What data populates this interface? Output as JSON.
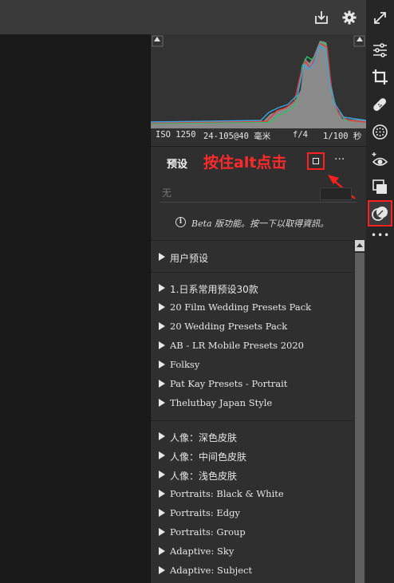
{
  "topbar": {
    "export_icon": "export-icon",
    "settings_icon": "gear-icon"
  },
  "exif": {
    "iso": "ISO 1250",
    "lens": "24-105@40 毫米",
    "aperture": "f/4",
    "shutter": "1/100 秒"
  },
  "presets": {
    "title": "预设",
    "annotation": "按住alt点击",
    "more_label": "···",
    "search_placeholder": "无",
    "beta_info_glyph": "i",
    "beta_notice": "Beta 版功能。按一下以取得資訊。"
  },
  "groups": [
    {
      "items": [
        "用户预设"
      ]
    },
    {
      "items": [
        "1.日系常用预设30款",
        "20 Film Wedding Presets Pack",
        "20 Wedding Presets Pack",
        "AB - LR Mobile Presets 2020",
        "Folksy",
        "Pat Kay Presets - Portrait",
        "Thelutbay Japan Style"
      ]
    },
    {
      "items": [
        "人像：深色皮肤",
        "人像：中间色皮肤",
        "人像：浅色皮肤",
        "Portraits: Black & White",
        "Portraits: Edgy",
        "Portraits: Group",
        "Adaptive: Sky",
        "Adaptive: Subject"
      ]
    }
  ],
  "toolbar": {
    "icons": [
      "expand-icon",
      "sliders-icon",
      "crop-icon",
      "healing-icon",
      "mask-icon",
      "redeye-icon",
      "snapshots-icon",
      "presets-icon",
      "more-icon"
    ],
    "more_label": "•••",
    "active": "presets-icon"
  },
  "colors": {
    "accent_red": "#ff2020",
    "panel_bg": "#2f2f2f",
    "toolbar_bg": "#262626"
  }
}
